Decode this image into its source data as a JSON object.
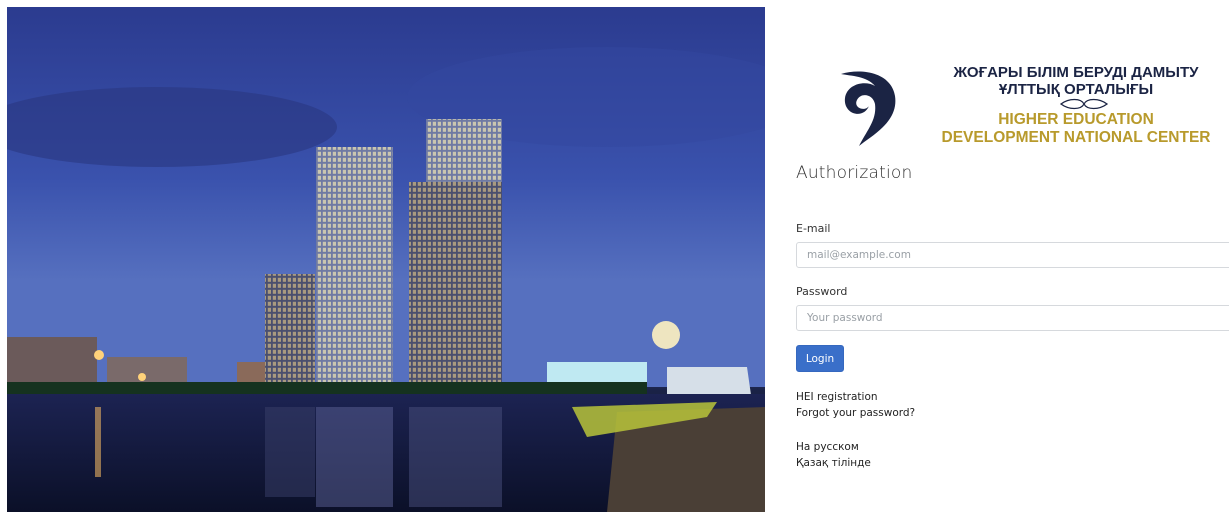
{
  "brand": {
    "kz_line1": "ЖОҒАРЫ БІЛІМ БЕРУДІ ДАМЫТУ",
    "kz_line2": "ҰЛТТЫҚ ОРТАЛЫҒЫ",
    "en_line1": "HIGHER EDUCATION",
    "en_line2": "DEVELOPMENT NATIONAL  CENTER",
    "color_navy": "#1b2444",
    "color_gold": "#b89a2c"
  },
  "form": {
    "title": "Authorization",
    "email_label": "E-mail",
    "email_placeholder": "mail@example.com",
    "email_value": "",
    "password_label": "Password",
    "password_placeholder": "Your password",
    "password_value": "",
    "login_button": "Login",
    "accent_color": "#3a6fc9"
  },
  "links": {
    "hei_registration": "HEI registration",
    "forgot_password": "Forgot your password?",
    "lang_ru": "На русском",
    "lang_kz": "Қазақ тілінде"
  },
  "photo": {
    "subject": "night city skyline with towers reflected in river",
    "icon": "city-photo"
  }
}
